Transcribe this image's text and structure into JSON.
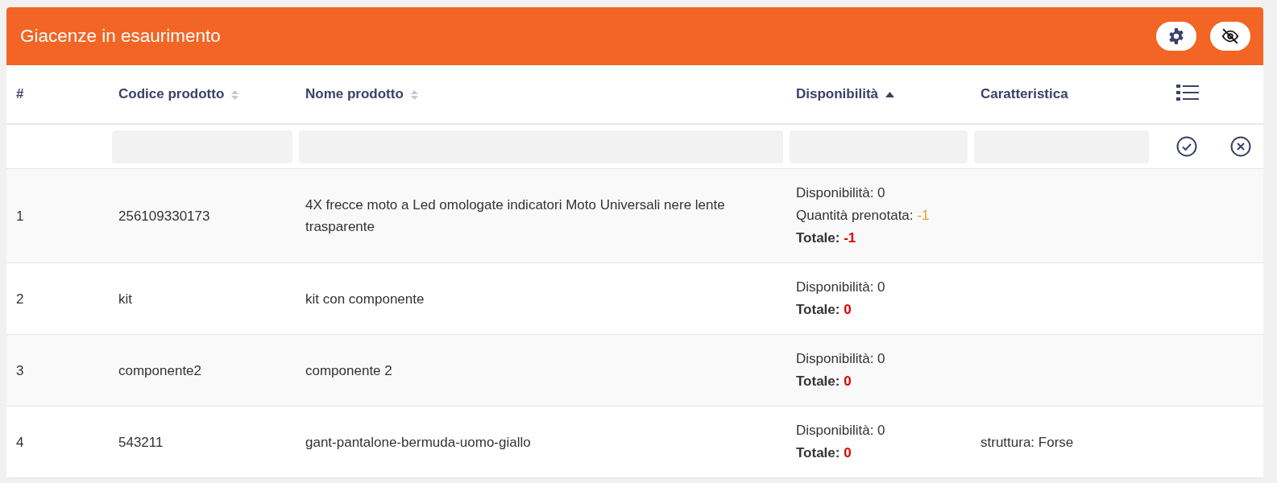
{
  "panel": {
    "title": "Giacenze in esaurimento"
  },
  "table": {
    "columns": [
      {
        "label": "#",
        "sortable": false,
        "selected": false
      },
      {
        "label": "Codice prodotto",
        "sortable": true,
        "selected": false
      },
      {
        "label": "Nome prodotto",
        "sortable": true,
        "selected": false
      },
      {
        "label": "Disponibilità",
        "sortable": true,
        "selected": true
      },
      {
        "label": "Caratteristica",
        "sortable": false,
        "selected": false
      }
    ],
    "rows": [
      {
        "index": "1",
        "code": "256109330173",
        "name": "4X frecce moto a Led omologate indicatori Moto Universali nere lente trasparente",
        "stock": [
          {
            "kind": "plain",
            "label": "Disponibilità:",
            "value": "0"
          },
          {
            "kind": "reserved",
            "label": "Quantità prenotata:",
            "value": "-1"
          },
          {
            "kind": "total",
            "label": "Totale:",
            "value": "-1"
          }
        ]
      },
      {
        "index": "2",
        "code": "kit",
        "name": "kit con componente",
        "stock": [
          {
            "kind": "plain",
            "label": "Disponibilità:",
            "value": "0"
          },
          {
            "kind": "total",
            "label": "Totale:",
            "value": "0"
          }
        ]
      },
      {
        "index": "3",
        "code": "componente2",
        "name": "componente 2",
        "stock": [
          {
            "kind": "plain",
            "label": "Disponibilità:",
            "value": "0"
          },
          {
            "kind": "total",
            "label": "Totale:",
            "value": "0"
          }
        ]
      },
      {
        "index": "4",
        "code": "543211",
        "name": "gant-pantalone-bermuda-uomo-giallo",
        "stock": [
          {
            "kind": "plain",
            "label": "Disponibilità:",
            "value": "0"
          },
          {
            "kind": "total",
            "label": "Totale:",
            "value": "0"
          }
        ],
        "feature": "struttura: Forse"
      }
    ]
  }
}
